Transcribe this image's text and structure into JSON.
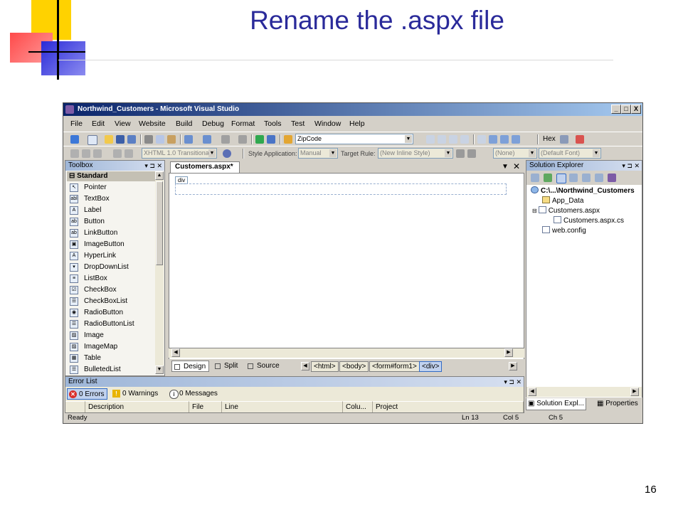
{
  "slide": {
    "title": "Rename the .aspx file",
    "page_number": "16"
  },
  "window": {
    "title": "Northwind_Customers - Microsoft Visual Studio",
    "controls": [
      "_",
      "□",
      "X"
    ]
  },
  "menu": [
    "File",
    "Edit",
    "View",
    "Website",
    "Build",
    "Debug",
    "Format",
    "Tools",
    "Test",
    "Window",
    "Help"
  ],
  "toolbar1": {
    "find_combo": "ZipCode",
    "hex_label": "Hex"
  },
  "toolbar2": {
    "doctype_combo": "XHTML 1.0 Transitional (",
    "style_application_label": "Style Application:",
    "style_application_value": "Manual",
    "target_rule_label": "Target Rule:",
    "target_rule_value": "(New Inline Style)",
    "font_size_value": "(None)",
    "font_value": "(Default Font)"
  },
  "toolbox": {
    "title": "Toolbox",
    "group": "Standard",
    "items": [
      "Pointer",
      "TextBox",
      "Label",
      "Button",
      "LinkButton",
      "ImageButton",
      "HyperLink",
      "DropDownList",
      "ListBox",
      "CheckBox",
      "CheckBoxList",
      "RadioButton",
      "RadioButtonList",
      "Image",
      "ImageMap",
      "Table",
      "BulletedList"
    ],
    "icons": [
      "↖",
      "abl",
      "A",
      "ab",
      "ab",
      "▣",
      "A",
      "▾",
      "≡",
      "☑",
      "☰",
      "◉",
      "☰",
      "▨",
      "▨",
      "▦",
      "☰"
    ]
  },
  "editor": {
    "tab_label": "Customers.aspx*",
    "div_tag": "div",
    "views": [
      "Design",
      "Split",
      "Source"
    ],
    "breadcrumbs": [
      "<html>",
      "<body>",
      "<form#form1>",
      "<div>"
    ]
  },
  "solution_explorer": {
    "title": "Solution Explorer",
    "tree": [
      {
        "label": "C:\\...\\Northwind_Customers",
        "kind": "project"
      },
      {
        "label": "App_Data",
        "kind": "folder"
      },
      {
        "label": "Customers.aspx",
        "kind": "file"
      },
      {
        "label": "Customers.aspx.cs",
        "kind": "file"
      },
      {
        "label": "web.config",
        "kind": "file"
      }
    ],
    "tabs": [
      "Solution Expl...",
      "Properties"
    ]
  },
  "error_list": {
    "title": "Error List",
    "errors": "0 Errors",
    "warnings": "0 Warnings",
    "messages": "0 Messages",
    "columns": [
      "Description",
      "File",
      "Line",
      "Colu...",
      "Project"
    ]
  },
  "status_bar": {
    "state": "Ready",
    "line": "Ln 13",
    "col": "Col 5",
    "ch": "Ch 5"
  },
  "colors": {
    "title_text": "#2a2a9a",
    "titlebar_start": "#0a246a",
    "titlebar_end": "#a6caf0",
    "chrome": "#d4d0c8"
  }
}
